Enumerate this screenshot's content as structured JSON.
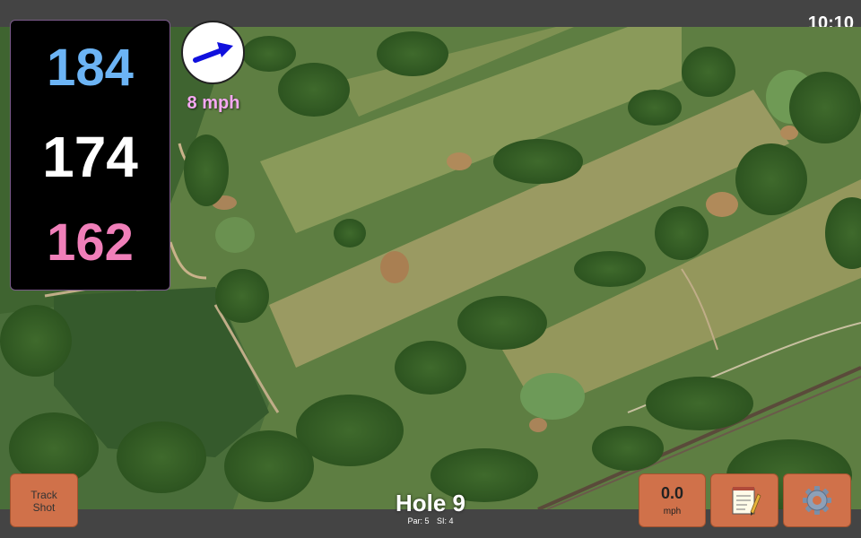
{
  "status_bar": {
    "time": "10:10"
  },
  "yardages": {
    "back": "184",
    "center": "174",
    "front": "162",
    "colors": {
      "back": "#6cb4f5",
      "center": "#ffffff",
      "front": "#f07fb9"
    }
  },
  "wind": {
    "speed_label": "8 mph",
    "arrow_color": "#1010dd",
    "label_color": "#f6a8f2",
    "icon": "wind-direction-arrow"
  },
  "buttons": {
    "track_shot_line1": "Track",
    "track_shot_line2": "Shot",
    "speed_value": "0.0",
    "speed_unit": "mph",
    "scorecard_icon": "notepad-icon",
    "settings_icon": "gear-icon",
    "accent": "#d0714a"
  },
  "hole": {
    "title": "Hole 9",
    "par_label": "Par: 5",
    "si_label": "SI: 4"
  }
}
